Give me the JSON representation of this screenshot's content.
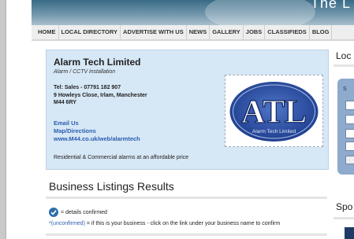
{
  "header": {
    "brand_text": "The L"
  },
  "nav": {
    "items": [
      "HOME",
      "LOCAL DIRECTORY",
      "ADVERTISE WITH US",
      "NEWS",
      "GALLERY",
      "JOBS",
      "CLASSIFIEDS",
      "BLOG"
    ]
  },
  "business": {
    "name": "Alarm Tech Limited",
    "subtitle": "Alarm / CCTV installation",
    "tel": "Tel: Sales - 07791 182 907",
    "address_line1": "9 Howleys Close, Irlam, Manchester",
    "address_line2": "M44 6RY",
    "email_label": "Email Us",
    "map_label": "Map/Directions",
    "web_label": "www.M44.co.uk/web/alarmtech",
    "description": "Residential & Commercial alarms at an affordable price",
    "logo": {
      "letters": "ATL",
      "tagline": "Alarm   Tech   Limited"
    }
  },
  "listings": {
    "title": "Business Listings Results",
    "confirmed_text": "= details confirmed",
    "unconfirmed_label": "*(unconfirmed)",
    "unconfirmed_text": " = if this is your business - click on the link under your business name to confirm"
  },
  "sidebar": {
    "title_1": "Loc",
    "search_label": "S",
    "title_2": "Spo"
  },
  "colors": {
    "card_bg": "#d6e7f5",
    "link": "#2a5db0",
    "logo_blue": "#1f3f8f",
    "sidebar_panel": "#8eaacc"
  }
}
